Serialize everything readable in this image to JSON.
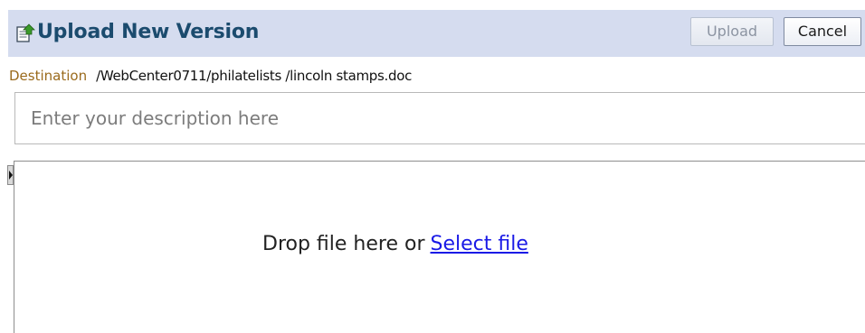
{
  "dialog": {
    "title": "Upload New Version",
    "title_icon": "upload-document-icon",
    "buttons": {
      "upload_label": "Upload",
      "upload_enabled": false,
      "cancel_label": "Cancel"
    }
  },
  "destination": {
    "label": "Destination",
    "path": "/WebCenter0711/philatelists /lincoln stamps.doc"
  },
  "description": {
    "placeholder": "Enter your description here",
    "value": ""
  },
  "drop_zone": {
    "text": "Drop file here or",
    "link_label": "Select file"
  },
  "splitter": {
    "icon": "expand-arrow-icon"
  },
  "colors": {
    "title_bar": "#d5dcef",
    "title_text": "#1b4b6e",
    "destination_label": "#9a6a1c",
    "link": "#1a1ae6"
  }
}
